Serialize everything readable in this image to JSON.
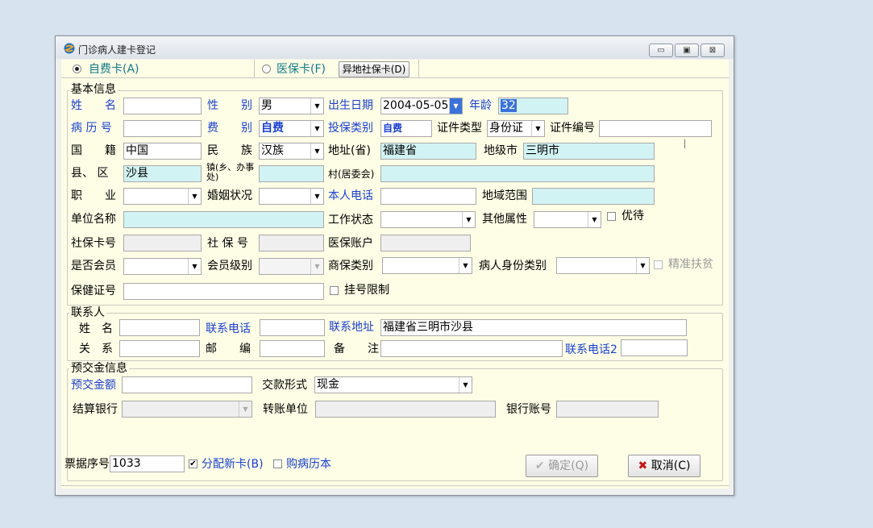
{
  "window": {
    "title": "门诊病人建卡登记",
    "btn_min": "▭",
    "btn_max": "▣",
    "btn_close": "⊠"
  },
  "topbar": {
    "self_pay_card": "自费卡(A)",
    "insurance_card": "医保卡(F)",
    "remote_card_button": "异地社保卡(D)"
  },
  "basic": {
    "legend": "基本信息",
    "name_label": "姓　　名",
    "name_value": "",
    "sex_label": "性　　别",
    "sex_value": "男",
    "dob_label": "出生日期",
    "dob_value": "2004-05-05",
    "age_label": "年龄",
    "age_value": "32",
    "record_label": "病 历 号",
    "record_value": "",
    "fee_label": "费　　别",
    "fee_value": "自费",
    "ins_type_label": "投保类别",
    "ins_type_value": "自费",
    "id_type_label": "证件类型",
    "id_type_value": "身份证",
    "id_no_label": "证件编号",
    "id_no_value": "",
    "nation_label": "国　　籍",
    "nation_value": "中国",
    "ethnic_label": "民　　族",
    "ethnic_value": "汉族",
    "province_label": "地址(省)",
    "province_value": "福建省",
    "city_label": "地级市",
    "city_value": "三明市",
    "county_label": "县、 区",
    "county_value": "沙县",
    "town_label": "镇(乡、办事处)",
    "town_value": "",
    "village_label": "村(居委会)",
    "village_value": "",
    "job_label": "职　　业",
    "job_value": "",
    "marital_label": "婚姻状况",
    "marital_value": "",
    "phone_label": "本人电话",
    "phone_value": "",
    "region_label": "地域范围",
    "region_value": "",
    "employer_label": "单位名称",
    "employer_value": "",
    "work_status_label": "工作状态",
    "work_status_value": "",
    "other_attr_label": "其他属性",
    "other_attr_value": "",
    "priority_label": "优待",
    "ss_card_label": "社保卡号",
    "ss_card_value": "",
    "ss_no_label": "社 保 号",
    "ss_no_value": "",
    "med_acct_label": "医保账户",
    "med_acct_value": "",
    "member_label": "是否会员",
    "member_value": "",
    "member_level_label": "会员级别",
    "member_level_value": "",
    "commercial_label": "商保类别",
    "commercial_value": "",
    "identity_label": "病人身份类别",
    "identity_value": "",
    "poverty_label": "精准扶贫",
    "health_card_label": "保健证号",
    "health_card_value": "",
    "reg_limit_label": "挂号限制"
  },
  "contact": {
    "legend": "联系人",
    "name_label": "姓　名",
    "name_value": "",
    "phone_label": "联系电话",
    "phone_value": "",
    "address_label": "联系地址",
    "address_value": "福建省三明市沙县",
    "relation_label": "关　系",
    "relation_value": "",
    "postcode_label": "邮　　编",
    "postcode_value": "",
    "remark_label": "备　　注",
    "remark_value": "",
    "phone2_label": "联系电话2",
    "phone2_value": ""
  },
  "deposit": {
    "legend": "预交金信息",
    "amount_label": "预交金额",
    "amount_value": "",
    "pay_method_label": "交款形式",
    "pay_method_value": "现金",
    "bank_label": "结算银行",
    "bank_value": "",
    "transfer_label": "转账单位",
    "transfer_value": "",
    "account_label": "银行账号",
    "account_value": ""
  },
  "footer": {
    "receipt_label": "票据序号",
    "receipt_value": "1033",
    "assign_card_label": "分配新卡(B)",
    "buy_book_label": "购病历本",
    "confirm_label": "确定(Q)",
    "cancel_label": "取消(C)"
  },
  "colors": {
    "accent_blue": "#1a3fd0",
    "teal_label": "#127a86",
    "field_cyan": "#d2f3f3",
    "client_bg": "#fefee7",
    "cancel_icon": "#c81414"
  }
}
